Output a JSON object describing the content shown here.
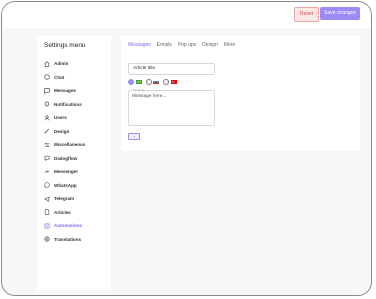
{
  "header": {
    "reset_label": "Reset",
    "save_label": "Save changes"
  },
  "sidebar": {
    "title": "Settings menu",
    "items": [
      {
        "label": "Admin",
        "icon": "home-icon"
      },
      {
        "label": "Chat",
        "icon": "chat-icon"
      },
      {
        "label": "Messages",
        "icon": "message-icon"
      },
      {
        "label": "Notifications",
        "icon": "bell-icon"
      },
      {
        "label": "Users",
        "icon": "users-icon"
      },
      {
        "label": "Design",
        "icon": "brush-icon"
      },
      {
        "label": "Miscellaneous",
        "icon": "sliders-icon"
      },
      {
        "label": "Dialogflow",
        "icon": "dialogflow-icon"
      },
      {
        "label": "Messenger",
        "icon": "messenger-icon"
      },
      {
        "label": "WhatsApp",
        "icon": "whatsapp-icon"
      },
      {
        "label": "Telegram",
        "icon": "telegram-icon"
      },
      {
        "label": "Articles",
        "icon": "article-icon"
      },
      {
        "label": "Automations",
        "icon": "automation-icon",
        "active": true
      },
      {
        "label": "Translations",
        "icon": "globe-icon"
      }
    ]
  },
  "main": {
    "tabs": [
      {
        "label": "Messages",
        "active": true
      },
      {
        "label": "Emails"
      },
      {
        "label": "Pop ups"
      },
      {
        "label": "Design"
      },
      {
        "label": "More"
      }
    ],
    "title_value": "Article title",
    "message_label": "Message",
    "message_placeholder": "Message here...",
    "add_label": "+",
    "languages": [
      {
        "name": "brazil-flag",
        "selected": true
      },
      {
        "name": "russia-flag",
        "selected": false
      },
      {
        "name": "turkey-flag",
        "selected": false
      }
    ]
  },
  "colors": {
    "accent": "#9b8cf5",
    "reset": "#d04b4b",
    "background": "#f7f7fa"
  }
}
